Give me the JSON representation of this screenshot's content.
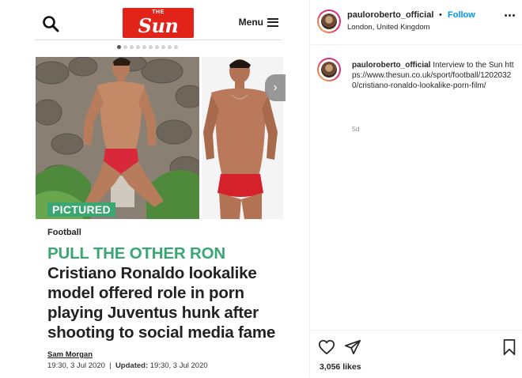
{
  "article": {
    "logo_small": "THE",
    "logo_word": "Sun",
    "menu_label": "Menu",
    "badge": "PICTURED",
    "section": "Football",
    "kicker": "PULL THE OTHER RON",
    "headline": "Cristiano Ronaldo lookalike model offered role in porn playing Juventus hunk after shooting to social media fame",
    "author": "Sam Morgan",
    "published": "19:30, 3 Jul 2020",
    "updated_label": "Updated:",
    "updated": "19:30, 3 Jul 2020",
    "carousel_dot_count": 10,
    "carousel_active_index": 0,
    "icons": [
      "search-icon",
      "hamburger-icon",
      "chevron-right-icon"
    ]
  },
  "post": {
    "username": "pauloroberto_official",
    "separator": "•",
    "follow_label": "Follow",
    "location": "London, United Kingdom",
    "caption_user": "pauloroberto_official",
    "caption_text": "Interview to the Sun https://www.thesun.co.uk/sport/football/12020320/cristiano-ronaldo-lookalike-porn-film/",
    "age": "5d",
    "likes": "3,056 likes",
    "colors": {
      "follow": "#0095f6",
      "badge": "#3aa773",
      "logo": "#e2231a"
    },
    "icons": [
      "heart-icon",
      "share-icon",
      "bookmark-icon",
      "more-icon"
    ]
  }
}
